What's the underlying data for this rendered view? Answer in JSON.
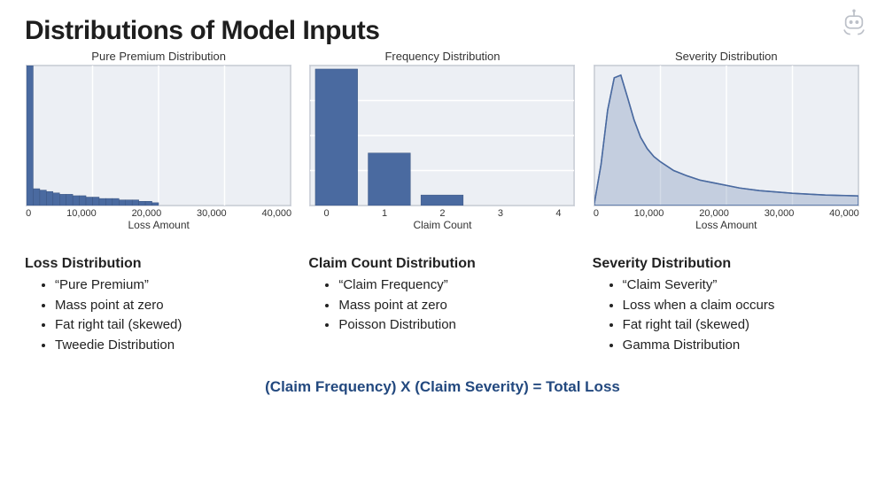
{
  "title": "Distributions of Model Inputs",
  "formula": "(Claim Frequency) X (Claim Severity) = Total Loss",
  "charts": [
    {
      "title": "Pure Premium Distribution",
      "xlabel": "Loss Amount",
      "ticks": [
        "0",
        "10,000",
        "20,000",
        "30,000",
        "40,000"
      ]
    },
    {
      "title": "Frequency Distribution",
      "xlabel": "Claim Count",
      "ticks": [
        "0",
        "1",
        "2",
        "3",
        "4"
      ]
    },
    {
      "title": "Severity Distribution",
      "xlabel": "Loss Amount",
      "ticks": [
        "0",
        "10,000",
        "20,000",
        "30,000",
        "40,000"
      ]
    }
  ],
  "sections": [
    {
      "heading": "Loss Distribution",
      "items": [
        "“Pure Premium”",
        "Mass point at zero",
        "Fat right tail (skewed)",
        "Tweedie Distribution"
      ]
    },
    {
      "heading": "Claim Count Distribution",
      "items": [
        "“Claim Frequency”",
        "Mass point at zero",
        "Poisson Distribution"
      ]
    },
    {
      "heading": "Severity Distribution",
      "items": [
        "“Claim Severity”",
        "Loss when a claim occurs",
        "Fat right tail (skewed)",
        "Gamma Distribution"
      ]
    }
  ],
  "chart_data": [
    {
      "type": "bar",
      "title": "Pure Premium Distribution",
      "xlabel": "Loss Amount",
      "ylabel": "",
      "xlim": [
        0,
        40000
      ],
      "ylim": [
        0,
        100
      ],
      "bin_edges": [
        0,
        1000,
        2000,
        3000,
        4000,
        5000,
        6000,
        7000,
        8000,
        9000,
        10000,
        11000,
        12000,
        13000,
        14000,
        15000,
        16000,
        17000,
        18000,
        19000,
        20000
      ],
      "values": [
        100,
        12,
        11,
        10,
        9,
        8,
        8,
        7,
        7,
        6,
        6,
        5,
        5,
        5,
        4,
        4,
        4,
        3,
        3,
        2
      ]
    },
    {
      "type": "bar",
      "title": "Frequency Distribution",
      "xlabel": "Claim Count",
      "ylabel": "",
      "categories": [
        0,
        1,
        2,
        3,
        4
      ],
      "values": [
        100,
        38,
        8,
        0,
        0
      ],
      "xlim": [
        -0.5,
        4.5
      ],
      "ylim": [
        0,
        100
      ]
    },
    {
      "type": "line",
      "title": "Severity Distribution",
      "xlabel": "Loss Amount",
      "ylabel": "",
      "xlim": [
        0,
        40000
      ],
      "ylim": [
        0,
        100
      ],
      "x": [
        0,
        1000,
        2000,
        3000,
        4000,
        5000,
        6000,
        7000,
        8000,
        9000,
        10000,
        12000,
        14000,
        16000,
        18000,
        20000,
        22000,
        25000,
        30000,
        35000,
        40000
      ],
      "values": [
        2,
        30,
        70,
        94,
        96,
        80,
        63,
        50,
        42,
        36,
        32,
        26,
        22,
        19,
        17,
        15,
        13,
        11,
        9,
        8,
        7
      ]
    }
  ]
}
